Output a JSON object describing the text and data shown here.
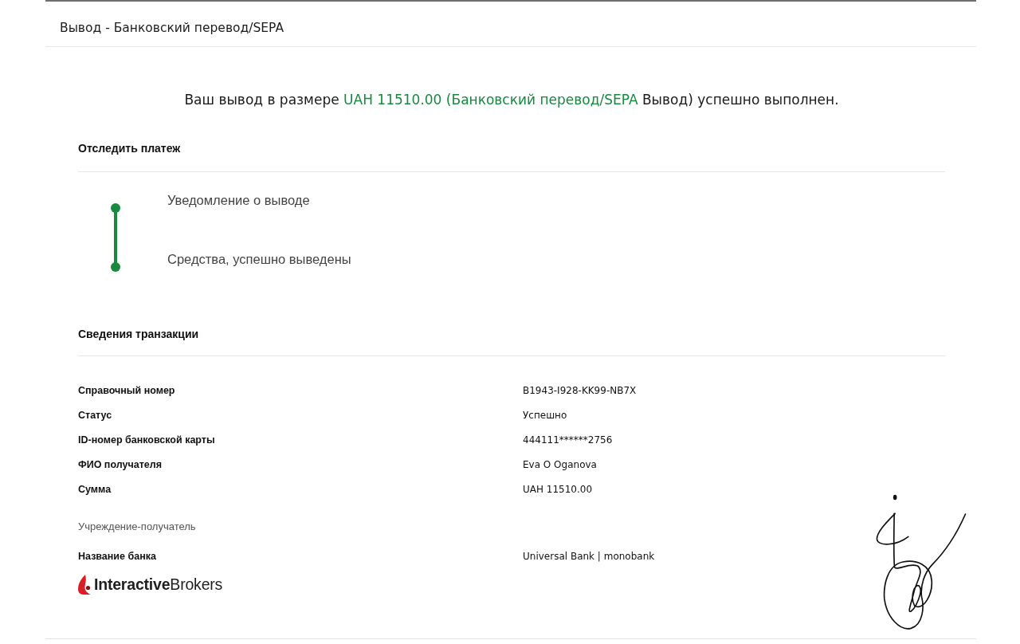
{
  "page": {
    "title": "Вывод - Банковский перевод/SEPA"
  },
  "confirmation": {
    "segments": [
      {
        "text": "Ваш вывод в размере ",
        "highlight": false
      },
      {
        "text": "UAH 11510.00",
        "highlight": true
      },
      {
        "text": " (Банковский перевод/SEPA",
        "highlight": true
      },
      {
        "text": " Вывод) успешно выполнен.",
        "highlight": false
      }
    ]
  },
  "tracking": {
    "heading": "Отследить платеж",
    "steps": [
      {
        "label": "Уведомление о выводе",
        "done": true
      },
      {
        "label": "Средства, успешно выведены",
        "done": true
      }
    ]
  },
  "transaction": {
    "heading": "Сведения транзакции",
    "rows": [
      {
        "label": "Справочный номер",
        "value": "B1943-I928-KK99-NB7X"
      },
      {
        "label": "Статус",
        "value": "Успешно"
      },
      {
        "label": "ID-номер банковской карты",
        "value": "444111******2756"
      },
      {
        "label": "ФИО получателя",
        "value": "Eva O Oganova"
      },
      {
        "label": "Сумма",
        "value": "UAH 11510.00"
      }
    ],
    "beneficiary": {
      "heading": "Учреждение-получатель",
      "rows": [
        {
          "label": "Название банка",
          "value": "Universal Bank | monobank"
        }
      ]
    }
  },
  "logo": {
    "text": "**Interactive**Brokers"
  }
}
